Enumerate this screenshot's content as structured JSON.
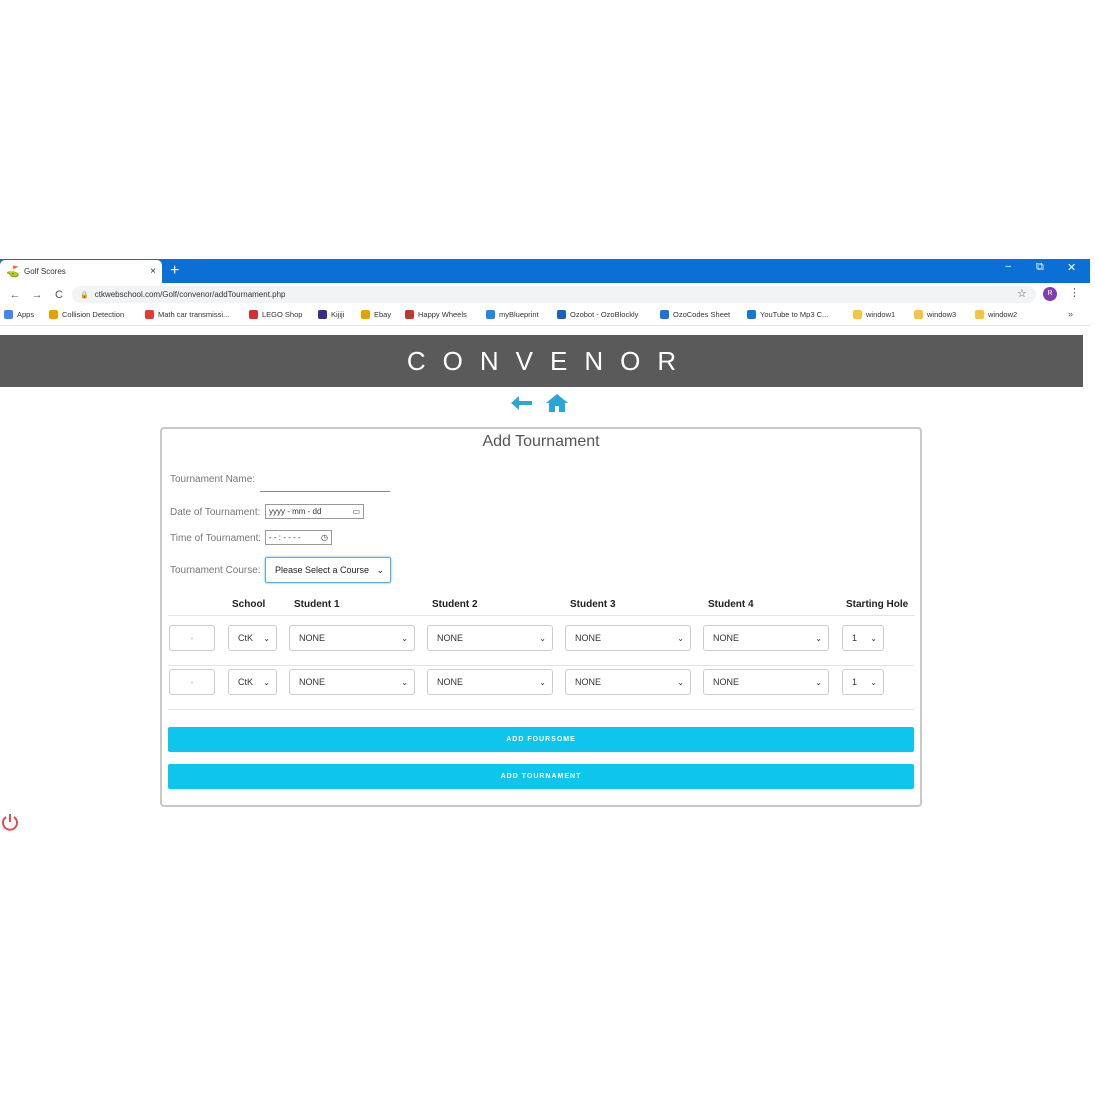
{
  "browser": {
    "tab_title": "Golf Scores",
    "tab_close": "×",
    "new_tab": "+",
    "win_min": "−",
    "win_max": "⧉",
    "win_close": "✕",
    "back": "←",
    "forward": "→",
    "reload": "C",
    "url": "ctkwebschool.com/Golf/convenor/addTournament.php",
    "profile_initial": "R",
    "bookmarks": [
      {
        "label": "Apps",
        "color": "#4285f4"
      },
      {
        "label": "Collision Detection",
        "color": "#e6a000"
      },
      {
        "label": "Math car transmissi...",
        "color": "#e53935"
      },
      {
        "label": "LEGO Shop",
        "color": "#d32f2f"
      },
      {
        "label": "Kijiji",
        "color": "#3b2d84"
      },
      {
        "label": "Ebay",
        "color": "#e5a100"
      },
      {
        "label": "Happy Wheels",
        "color": "#c0392b"
      },
      {
        "label": "myBlueprint",
        "color": "#1e88e5"
      },
      {
        "label": "Ozobot - OzoBlockly",
        "color": "#1565c0"
      },
      {
        "label": "OzoCodes Sheet",
        "color": "#1976d2"
      },
      {
        "label": "YouTube to Mp3 C...",
        "color": "#1976d2"
      },
      {
        "label": "window1",
        "color": "#f6c343"
      },
      {
        "label": "window3",
        "color": "#f6c343"
      },
      {
        "label": "window2",
        "color": "#f6c343"
      }
    ],
    "bookmarks_more": "»"
  },
  "page": {
    "header_title": "CONVENOR",
    "back_icon": "back-arrow-icon",
    "home_icon": "home-icon",
    "accent": "#29a8d8",
    "button_color": "#0ec5ee"
  },
  "form": {
    "title": "Add Tournament",
    "name_label": "Tournament Name:",
    "date_label": "Date of Tournament:",
    "date_placeholder": "yyyy - mm - dd",
    "time_label": "Time of Tournament:",
    "time_placeholder": "- - : - -   - -",
    "course_label": "Tournament Course:",
    "course_value": "Please Select a Course",
    "columns": [
      "School",
      "Student 1",
      "Student 2",
      "Student 3",
      "Student 4",
      "Starting Hole"
    ],
    "rows": [
      {
        "num": "-",
        "school": "CtK",
        "s1": "NONE",
        "s2": "NONE",
        "s3": "NONE",
        "s4": "NONE",
        "hole": "1"
      },
      {
        "num": "-",
        "school": "CtK",
        "s1": "NONE",
        "s2": "NONE",
        "s3": "NONE",
        "s4": "NONE",
        "hole": "1"
      }
    ],
    "add_foursome": "ADD FOURSOME",
    "add_tournament": "ADD TOURNAMENT"
  }
}
